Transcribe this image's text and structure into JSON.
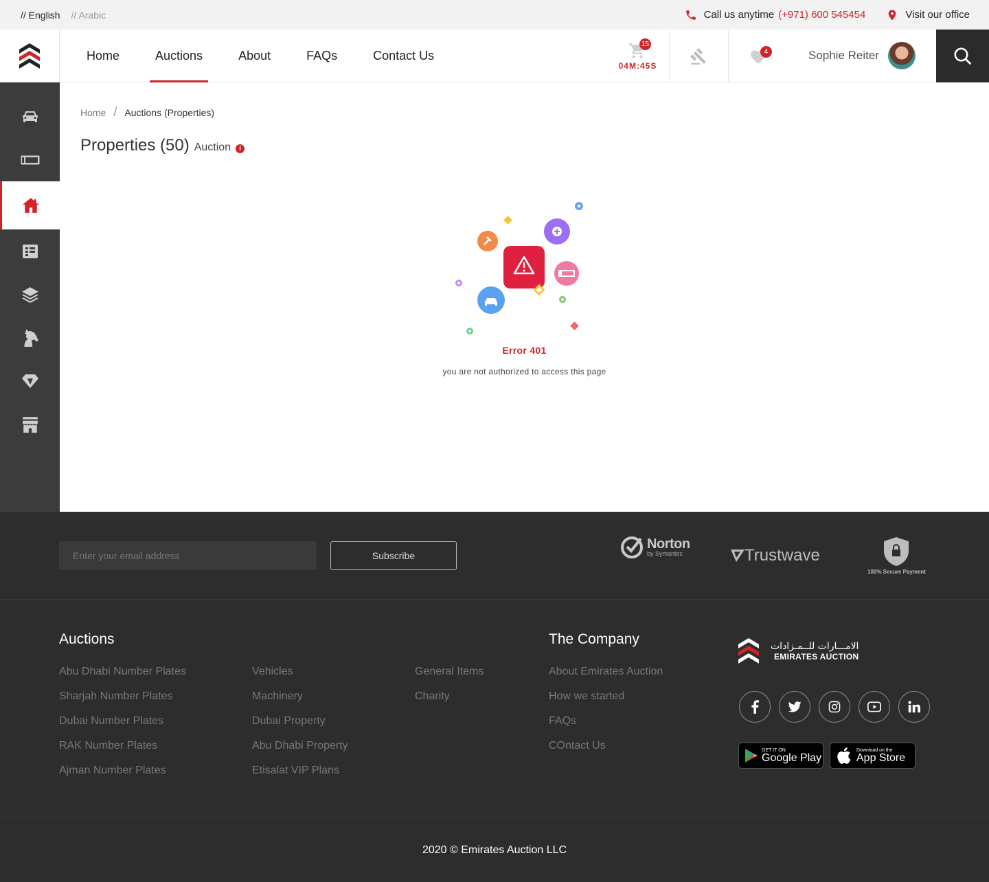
{
  "topbar": {
    "lang_en": "// English",
    "lang_ar": "// Arabic",
    "call_label": "Call us anytime",
    "phone": "(+971) 600 545454",
    "office": "Visit our office"
  },
  "nav": {
    "items": [
      "Home",
      "Auctions",
      "About",
      "FAQs",
      "Contact Us"
    ],
    "active": "Auctions"
  },
  "header": {
    "cart_count": "15",
    "timer": "04M:45S",
    "fav_count": "4",
    "user_name": "Sophie Reiter"
  },
  "breadcrumb": {
    "home": "Home",
    "current": "Auctions (Properties)"
  },
  "page": {
    "title": "Properties (50)",
    "subtitle": "Auction",
    "info_icon": "i"
  },
  "error": {
    "title": "Error 401",
    "message": "you are not authorized to access this page"
  },
  "footer": {
    "email_placeholder": "Enter your email address",
    "subscribe": "Subscribe",
    "norton_big": "Norton",
    "norton_small": "by Symantec",
    "trustwave": "Trustwave",
    "secure_label": "100% Secure Payment",
    "auctions_title": "Auctions",
    "auctions_col1": [
      "Abu Dhabi Number Plates",
      "Sharjah Number Plates",
      "Dubai Number Plates",
      "RAK Number Plates",
      "Ajman Number Plates"
    ],
    "auctions_col2": [
      "Vehicles",
      "Machinery",
      "Dubai Property",
      "Abu Dhabi Property",
      "Etisalat VIP Plans"
    ],
    "auctions_col3": [
      "General Items",
      "Charity"
    ],
    "company_title": "The Company",
    "company_links": [
      "About Emirates Auction",
      "How we started",
      "FAQs",
      "COntact Us"
    ],
    "brand_ar": "الامـــارات للــمـزادات",
    "brand_en": "EMIRATES AUCTION",
    "google_small": "GET IT ON",
    "google_big": "Google Play",
    "apple_small": "Download on the",
    "apple_big": "App Store",
    "copyright": "2020 © Emirates Auction LLC"
  },
  "colors": {
    "accent": "#d2232a",
    "sidebar": "#3c3c3c",
    "footer": "#2d2d2d"
  },
  "icons": {
    "sidebar": [
      "car-icon",
      "plate-icon",
      "home-icon",
      "list-icon",
      "layers-icon",
      "horse-icon",
      "diamond-icon",
      "store-icon"
    ],
    "social": [
      "facebook-icon",
      "twitter-icon",
      "instagram-icon",
      "youtube-icon",
      "linkedin-icon"
    ]
  }
}
